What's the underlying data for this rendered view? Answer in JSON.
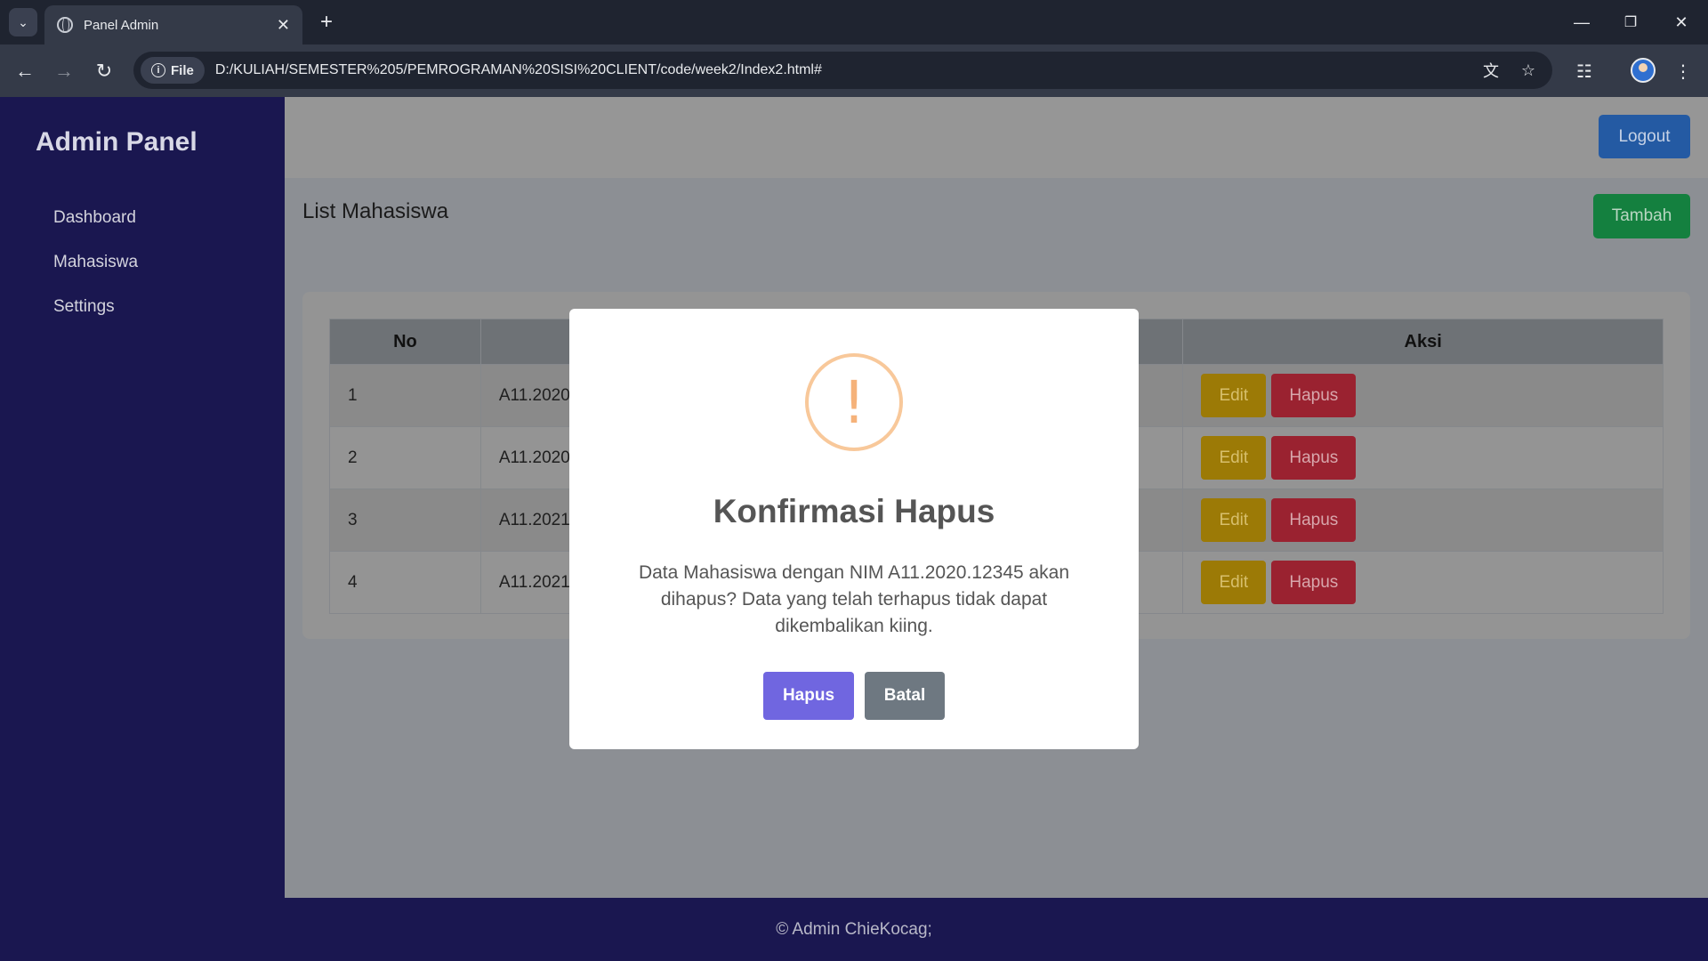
{
  "browser": {
    "tab_title": "Panel Admin",
    "site_chip": "File",
    "url": "D:/KULIAH/SEMESTER%205/PEMROGRAMAN%20SISI%20CLIENT/code/week2/Index2.html#",
    "icons": [
      "tab-list-icon",
      "globe-icon",
      "close-icon",
      "plus-icon",
      "minimize-icon",
      "restore-icon",
      "window-close-icon",
      "back-icon",
      "forward-icon",
      "reload-icon",
      "info-icon",
      "translate-icon",
      "star-icon",
      "extensions-icon",
      "profile-avatar",
      "more-icon"
    ]
  },
  "sidebar": {
    "brand": "Admin Panel",
    "items": [
      {
        "label": "Dashboard"
      },
      {
        "label": "Mahasiswa"
      },
      {
        "label": "Settings"
      }
    ]
  },
  "topbar": {
    "logout_label": "Logout"
  },
  "main": {
    "title": "List Mahasiswa",
    "add_label": "Tambah",
    "table": {
      "headers": [
        "No",
        "Aksi"
      ],
      "rows": [
        {
          "no": "1",
          "nim": "A11.2020"
        },
        {
          "no": "2",
          "nim": "A11.2020"
        },
        {
          "no": "3",
          "nim": "A11.2021"
        },
        {
          "no": "4",
          "nim": "A11.2021"
        }
      ],
      "edit_label": "Edit",
      "delete_label": "Hapus"
    }
  },
  "modal": {
    "icon": "!",
    "title": "Konfirmasi Hapus",
    "text": "Data Mahasiswa dengan NIM A11.2020.12345 akan dihapus? Data yang telah terhapus tidak dapat dikembalikan kiing.",
    "confirm_label": "Hapus",
    "cancel_label": "Batal"
  },
  "footer": {
    "text": "© Admin ChieKocag;"
  },
  "colors": {
    "sidebar": "#1a1750",
    "confirm": "#7066e0",
    "cancel": "#6e7881",
    "warning": "#f8c89a"
  }
}
